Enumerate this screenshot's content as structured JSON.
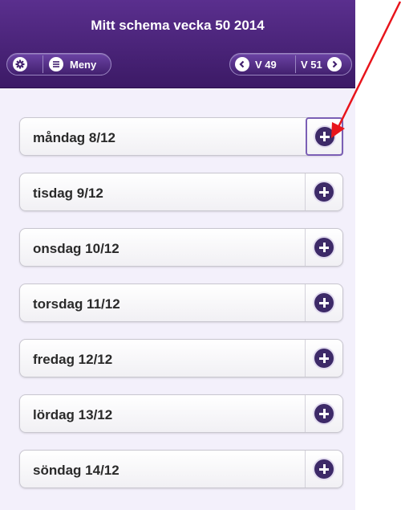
{
  "header": {
    "title": "Mitt schema vecka 50  2014",
    "menu_label": "Meny",
    "prev_week_label": "V 49",
    "next_week_label": "V 51"
  },
  "days": [
    {
      "label": "måndag 8/12",
      "highlighted": true
    },
    {
      "label": "tisdag 9/12"
    },
    {
      "label": "onsdag 10/12"
    },
    {
      "label": "torsdag 11/12"
    },
    {
      "label": "fredag 12/12"
    },
    {
      "label": "lördag 13/12"
    },
    {
      "label": "söndag 14/12"
    }
  ],
  "icons": {
    "settings": "gear-icon",
    "menu": "list-icon",
    "prev": "chevron-left-icon",
    "next": "chevron-right-icon",
    "add": "plus-icon",
    "annotation": "red-arrow"
  },
  "colors": {
    "header": "#4a2478",
    "background": "#f3f0fb",
    "add_button": "#3d2a68",
    "annotation_arrow": "#e8141b"
  }
}
